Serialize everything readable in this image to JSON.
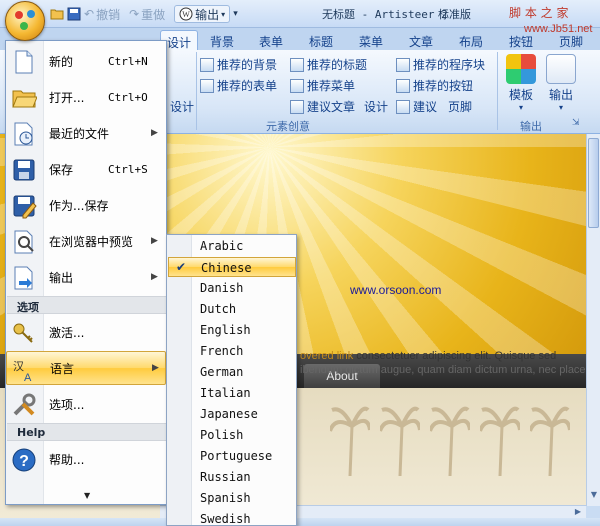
{
  "titlebar": {
    "undo_label": "撤销",
    "redo_label": "重做",
    "export_label": "输出",
    "title": "无标题 - Artisteer 2",
    "title_edition": "标准版",
    "watermark": "脚 本 之 家",
    "watermark_url": "www.Jb51.net"
  },
  "ribbon": {
    "tabs": [
      "设计",
      "背景",
      "表单",
      "标题",
      "菜单",
      "文章",
      "布局",
      "按钮",
      "页脚"
    ],
    "group_left_fragment": "设计",
    "items": {
      "suggest_bg": "推荐的背景",
      "suggest_form": "推荐的表单",
      "suggest_title": "推荐的标题",
      "suggest_menu": "推荐菜单",
      "suggest_article": "建议文章",
      "article_design": "设计",
      "suggest_block": "推荐的程序块",
      "suggest_button": "推荐的按钮",
      "suggest_footer_a": "建议",
      "suggest_footer_b": "页脚"
    },
    "group_elements": "元素创意",
    "template_label": "模板",
    "export_label": "输出",
    "group_export": "输出"
  },
  "app_menu": {
    "items": [
      {
        "label": "新的",
        "shortcut": "Ctrl+N",
        "icon": "new-document-icon"
      },
      {
        "label": "打开...",
        "shortcut": "Ctrl+O",
        "icon": "open-folder-icon"
      },
      {
        "label": "最近的文件",
        "shortcut": "",
        "icon": "recent-files-icon",
        "submenu": true
      },
      {
        "label": "保存",
        "shortcut": "Ctrl+S",
        "icon": "save-icon"
      },
      {
        "label": "作为...保存",
        "shortcut": "",
        "icon": "save-as-icon"
      },
      {
        "label": "在浏览器中预览",
        "shortcut": "",
        "icon": "preview-icon",
        "submenu": true
      },
      {
        "label": "输出",
        "shortcut": "",
        "icon": "export-icon",
        "submenu": true
      }
    ],
    "section_options": "选项",
    "options_items": [
      {
        "label": "激活...",
        "icon": "activate-key-icon"
      },
      {
        "label": "语言",
        "icon": "language-icon",
        "submenu": true,
        "highlighted": true
      },
      {
        "label": "选项...",
        "icon": "tools-icon"
      }
    ],
    "section_help": "Help",
    "help_items": [
      {
        "label": "帮助...",
        "icon": "help-icon"
      }
    ]
  },
  "language_menu": {
    "items": [
      "Arabic",
      "Chinese",
      "Danish",
      "Dutch",
      "English",
      "French",
      "German",
      "Italian",
      "Japanese",
      "Polish",
      "Portuguese",
      "Russian",
      "Spanish",
      "Swedish"
    ],
    "selected": "Chinese"
  },
  "preview": {
    "site_url": "www.orsoon.com",
    "nav_tab": "About",
    "text_link": "overed link",
    "text_line1": "consectetuer adipiscing elit. Quisque sed",
    "text_line2": "ibendum dictum augue, quam diam dictum urna, nec placerat el"
  },
  "colors": {
    "accent": "#ffcb3d",
    "ribbon_text": "#15428b",
    "header_gold": "#e8b41a",
    "nav_dark": "#262626"
  }
}
